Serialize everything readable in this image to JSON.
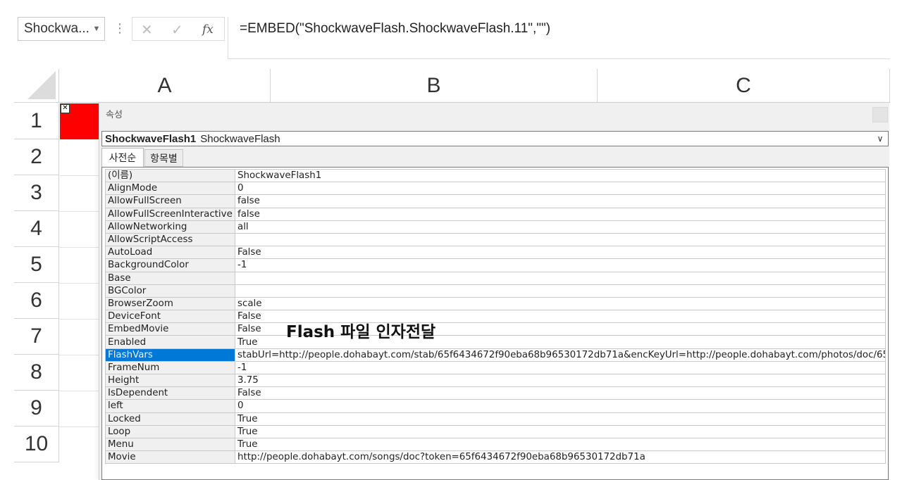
{
  "formula_bar": {
    "name_box": "Shockwa...",
    "formula": "=EMBED(\"ShockwaveFlash.ShockwaveFlash.11\",\"\")",
    "fx_label": "fx"
  },
  "sheet": {
    "columns": [
      "A",
      "B",
      "C"
    ],
    "rows": [
      "1",
      "2",
      "3",
      "4",
      "5",
      "6",
      "7",
      "8",
      "9",
      "10"
    ]
  },
  "properties_window": {
    "title": "속성",
    "object_name": "ShockwaveFlash1",
    "object_type": "ShockwaveFlash",
    "tabs": [
      "사전순",
      "항목별"
    ],
    "selected_property": "FlashVars",
    "properties": [
      {
        "name": "(이름)",
        "value": "ShockwaveFlash1"
      },
      {
        "name": "AlignMode",
        "value": "0"
      },
      {
        "name": "AllowFullScreen",
        "value": "false"
      },
      {
        "name": "AllowFullScreenInteractive",
        "value": "false"
      },
      {
        "name": "AllowNetworking",
        "value": "all"
      },
      {
        "name": "AllowScriptAccess",
        "value": ""
      },
      {
        "name": "AutoLoad",
        "value": "False"
      },
      {
        "name": "BackgroundColor",
        "value": "-1"
      },
      {
        "name": "Base",
        "value": ""
      },
      {
        "name": "BGColor",
        "value": ""
      },
      {
        "name": "BrowserZoom",
        "value": "scale"
      },
      {
        "name": "DeviceFont",
        "value": "False"
      },
      {
        "name": "EmbedMovie",
        "value": "False"
      },
      {
        "name": "Enabled",
        "value": "True"
      },
      {
        "name": "FlashVars",
        "value": "stabUrl=http://people.dohabayt.com/stab/65f6434672f90eba68b96530172db71a&encKeyUrl=http://people.dohabayt.com/photos/doc/65"
      },
      {
        "name": "FrameNum",
        "value": "-1"
      },
      {
        "name": "Height",
        "value": "3.75"
      },
      {
        "name": "IsDependent",
        "value": "False"
      },
      {
        "name": "left",
        "value": "0"
      },
      {
        "name": "Locked",
        "value": "True"
      },
      {
        "name": "Loop",
        "value": "True"
      },
      {
        "name": "Menu",
        "value": "True"
      },
      {
        "name": "Movie",
        "value": "http://people.dohabayt.com/songs/doc?token=65f6434672f90eba68b96530172db71a"
      }
    ]
  },
  "annotation": "Flash 파일 인자전달",
  "colors": {
    "selection": "#0078d7",
    "embedded_object": "#ff0000"
  }
}
